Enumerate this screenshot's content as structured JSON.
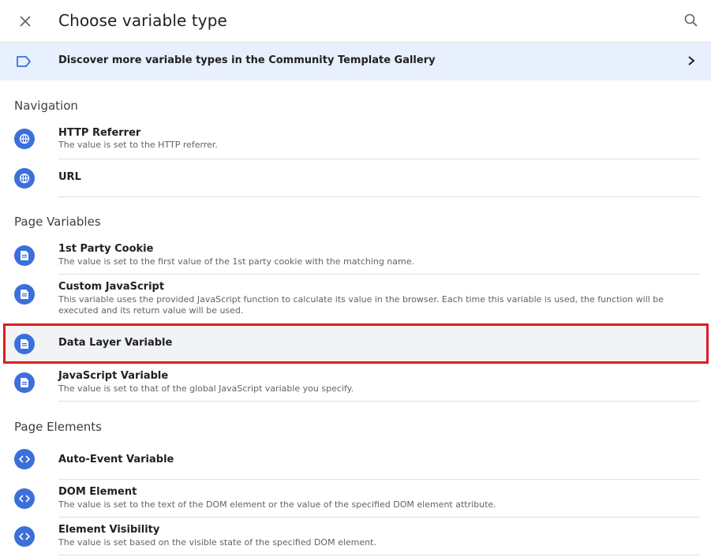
{
  "header": {
    "title": "Choose variable type",
    "close_icon": "close-icon",
    "search_icon": "search-icon"
  },
  "banner": {
    "text": "Discover more variable types in the Community Template Gallery",
    "icon": "tag-icon",
    "chevron": "chevron-right-icon"
  },
  "sections": {
    "navigation": "Navigation",
    "page_variables": "Page Variables",
    "page_elements": "Page Elements"
  },
  "items": {
    "http_referrer": {
      "name": "HTTP Referrer",
      "desc": "The value is set to the HTTP referrer.",
      "icon": "globe-icon"
    },
    "url": {
      "name": "URL",
      "desc": "",
      "icon": "globe-icon"
    },
    "first_party_cookie": {
      "name": "1st Party Cookie",
      "desc": "The value is set to the first value of the 1st party cookie with the matching name.",
      "icon": "document-icon"
    },
    "custom_js": {
      "name": "Custom JavaScript",
      "desc": "This variable uses the provided JavaScript function to calculate its value in the browser. Each time this variable is used, the function will be executed and its return value will be used.",
      "icon": "document-icon"
    },
    "data_layer": {
      "name": "Data Layer Variable",
      "desc": "",
      "icon": "document-icon"
    },
    "js_variable": {
      "name": "JavaScript Variable",
      "desc": "The value is set to that of the global JavaScript variable you specify.",
      "icon": "document-icon"
    },
    "auto_event": {
      "name": "Auto-Event Variable",
      "desc": "",
      "icon": "code-icon"
    },
    "dom_element": {
      "name": "DOM Element",
      "desc": "The value is set to the text of the DOM element or the value of the specified DOM element attribute.",
      "icon": "code-icon"
    },
    "element_visibility": {
      "name": "Element Visibility",
      "desc": "The value is set based on the visible state of the specified DOM element.",
      "icon": "code-icon"
    }
  },
  "colors": {
    "accent": "#3b6fdb",
    "banner_bg": "#e8f0fe",
    "highlight_border": "#e01b24"
  }
}
